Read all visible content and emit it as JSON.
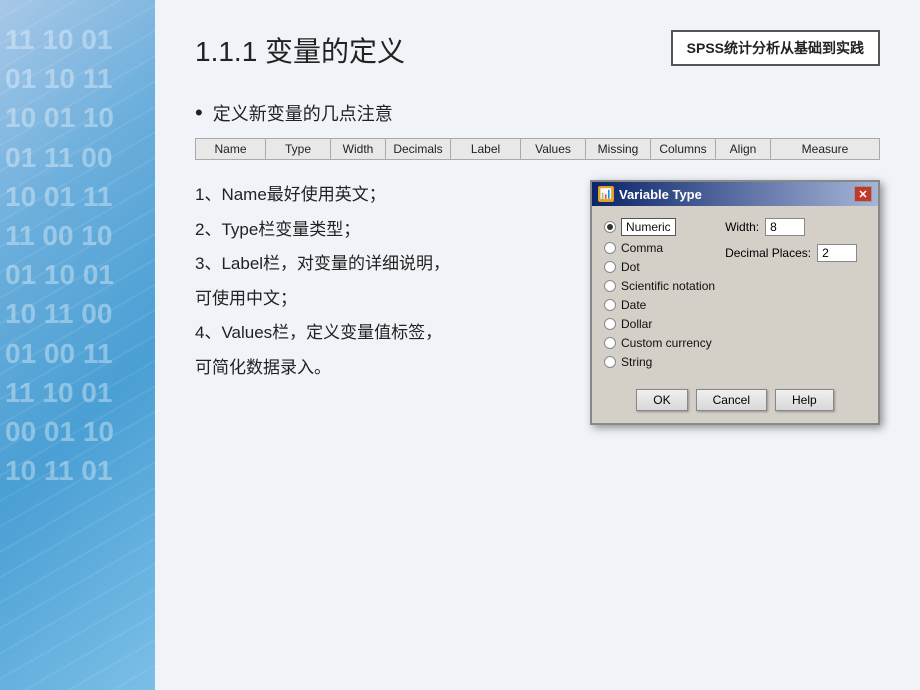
{
  "background": {
    "numbers": [
      "11 10 01",
      "01 10 11",
      "10 01 10",
      "01 11 00",
      "10 01 11"
    ]
  },
  "header": {
    "title": "1.1.1 变量的定义",
    "brand": "SPSS统计分析从基础到实践"
  },
  "bullet": {
    "label": "定义新变量的几点注意"
  },
  "spss_table": {
    "columns": [
      "Name",
      "Type",
      "Width",
      "Decimals",
      "Label",
      "Values",
      "Missing",
      "Columns",
      "Align",
      "Measure"
    ]
  },
  "text_content": {
    "line1": "1、Name最好使用英文；",
    "line2": "2、Type栏变量类型；",
    "line3": "3、Label栏，对变量的详细说明，",
    "line4": "可使用中文；",
    "line5": "4、Values栏，定义变量值标签，",
    "line6": "可简化数据录入。"
  },
  "dialog": {
    "title": "Variable Type",
    "close_label": "✕",
    "radio_options": [
      {
        "label": "Numeric",
        "selected": true
      },
      {
        "label": "Comma",
        "selected": false
      },
      {
        "label": "Dot",
        "selected": false
      },
      {
        "label": "Scientific notation",
        "selected": false
      },
      {
        "label": "Date",
        "selected": false
      },
      {
        "label": "Dollar",
        "selected": false
      },
      {
        "label": "Custom currency",
        "selected": false
      },
      {
        "label": "String",
        "selected": false
      }
    ],
    "width_label": "Width:",
    "width_value": "8",
    "decimal_label": "Decimal Places:",
    "decimal_value": "2",
    "buttons": [
      "OK",
      "Cancel",
      "Help"
    ]
  }
}
